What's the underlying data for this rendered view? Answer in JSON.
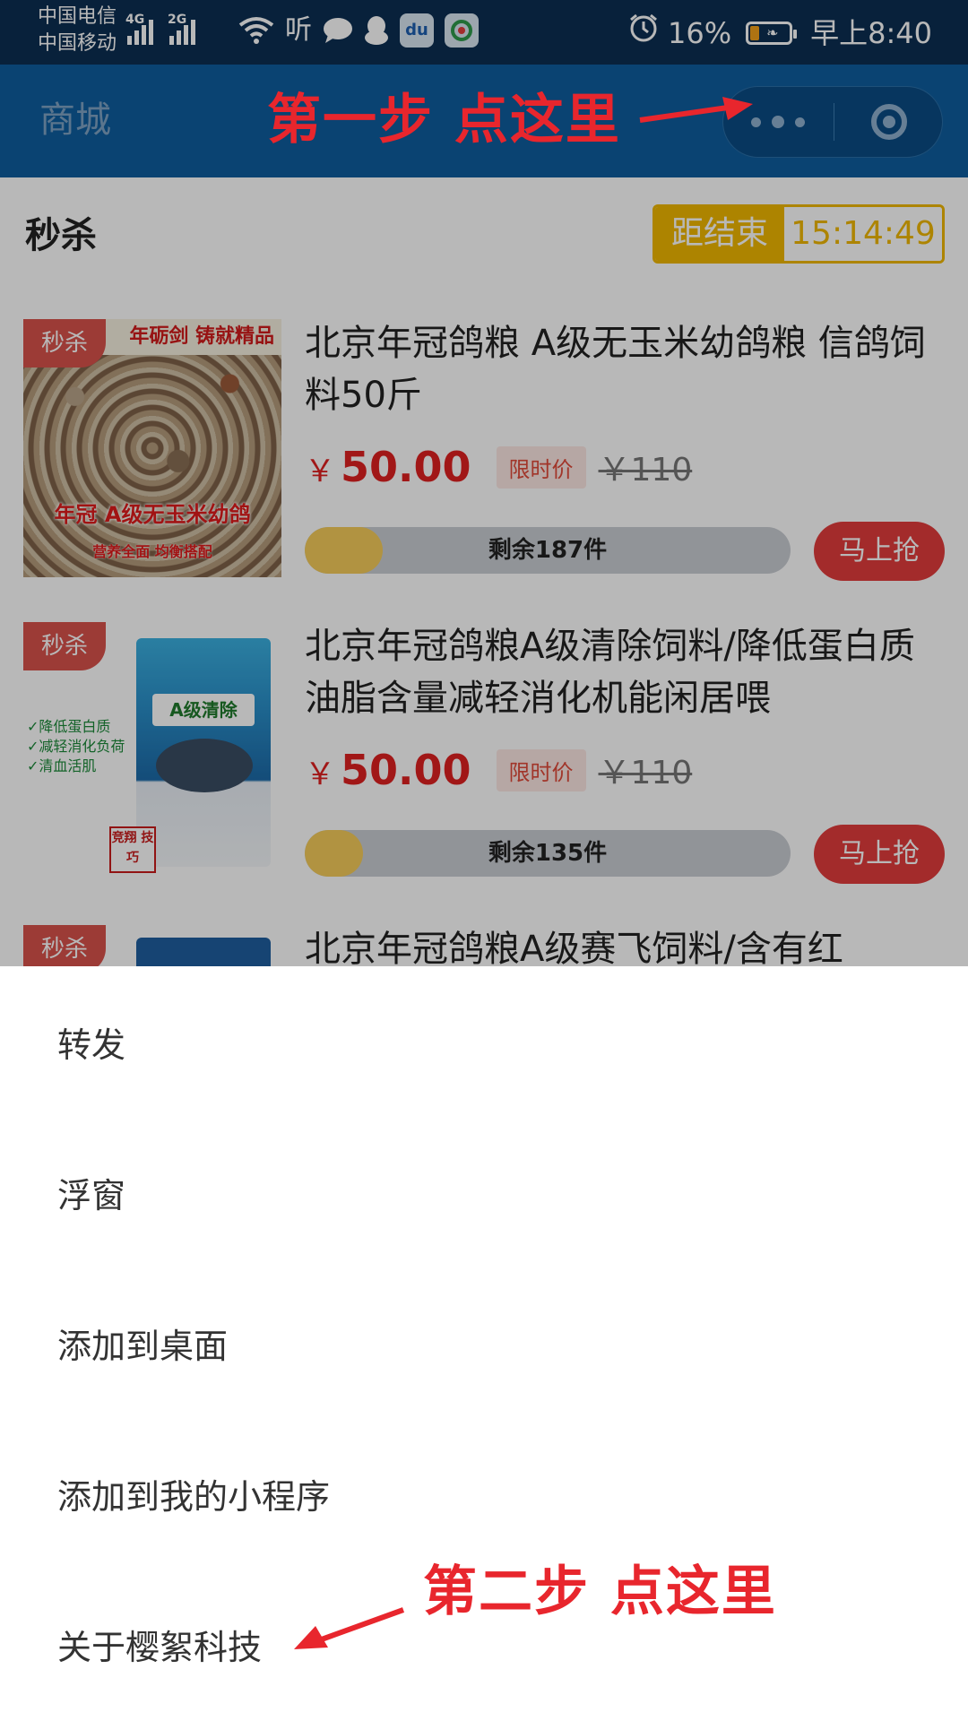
{
  "status_bar": {
    "carrier_1": "中国电信",
    "carrier_2": "中国移动",
    "net_1": "4G",
    "net_2": "2G",
    "icons": [
      "wifi-icon",
      "audio-app-icon",
      "chat-bubble-icon",
      "qq-penguin-icon",
      "baidu-app-icon",
      "camera-app-icon"
    ],
    "battery_percent": "16%",
    "time": "早上8:40"
  },
  "header": {
    "title": "商城"
  },
  "flash_sale": {
    "title": "秒杀",
    "countdown_label": "距结束",
    "countdown_value": "15:14:49",
    "badge": "秒杀",
    "products": [
      {
        "image_text_top": "年砺剑 铸就精品",
        "image_text_mid": "年冠 A级无玉米幼鸽",
        "image_text_low": "营养全面 均衡搭配",
        "title": "北京年冠鸽粮 A级无玉米幼鸽粮 信鸽饲料50斤",
        "price_symbol": "￥",
        "price": "50.00",
        "tag": "限时价",
        "original_price": "￥110",
        "stock_text": "剩余187件",
        "stock_fraction": 0.16,
        "buy_label": "马上抢"
      },
      {
        "image_text_top": "A级清除",
        "image_text_mid": "✓降低蛋白质",
        "image_text_low": "✓减轻消化负荷",
        "image_text_extra": "✓清血活肌",
        "image_stamp": "竞翔 技巧",
        "title": "北京年冠鸽粮A级清除饲料/降低蛋白质油脂含量减轻消化机能闲居喂",
        "price_symbol": "￥",
        "price": "50.00",
        "tag": "限时价",
        "original_price": "￥110",
        "stock_text": "剩余135件",
        "stock_fraction": 0.12,
        "buy_label": "马上抢"
      },
      {
        "title": "北京年冠鸽粮A级赛飞饲料/含有红"
      }
    ]
  },
  "menu": {
    "items": [
      "转发",
      "浮窗",
      "添加到桌面",
      "添加到我的小程序",
      "关于樱絮科技"
    ]
  },
  "annotations": {
    "step1": "第一步 点这里",
    "step2": "第二步 点这里",
    "color": "#e8262d"
  },
  "colors": {
    "status_bar": "#0c2f52",
    "header": "#0f5d9e",
    "accent_red": "#e02020",
    "timer_yellow": "#f0b800"
  }
}
